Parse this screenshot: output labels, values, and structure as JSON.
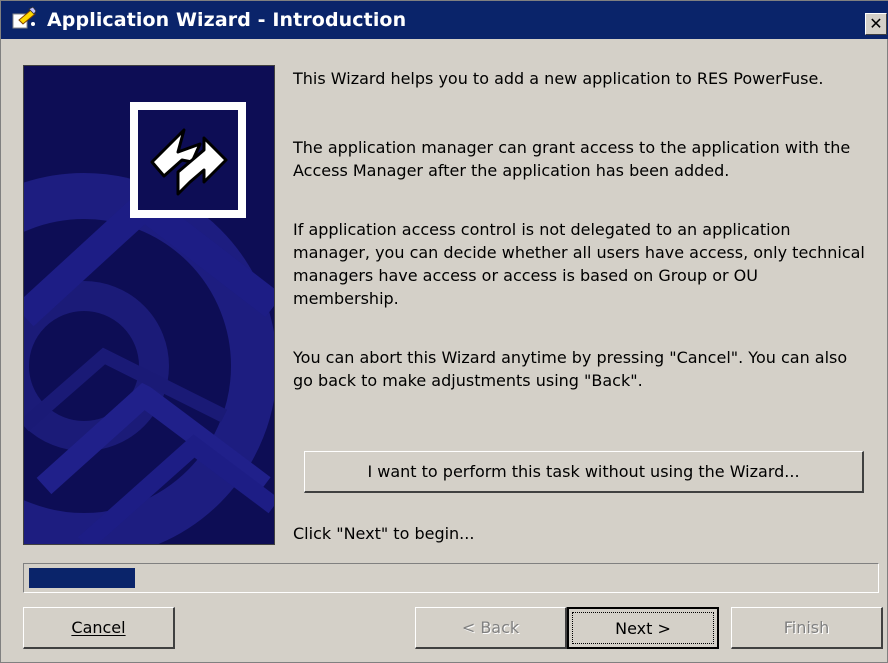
{
  "window": {
    "title": "Application Wizard - Introduction"
  },
  "intro": {
    "p1": "This Wizard helps you to add a new application to RES PowerFuse.",
    "p2": "The application manager can grant access to the application with the Access Manager after the application has been added.",
    "p3": "If application access control is not delegated to an application manager, you can decide whether all users have access, only technical managers have access or access is based on Group or OU membership.",
    "p4": "You can abort this Wizard anytime by pressing \"Cancel\". You can also go back to make adjustments using \"Back\".",
    "begin_hint": "Click \"Next\" to begin..."
  },
  "task_button_label": "I want to perform this task without using the Wizard...",
  "progress": {
    "value_fraction": 0.125
  },
  "buttons": {
    "cancel": "Cancel",
    "back": "< Back",
    "next": "Next >",
    "finish": "Finish"
  },
  "colors": {
    "titlebar": "#0a246a",
    "banner": "#0d0d55",
    "face": "#d4d0c8"
  },
  "icons": {
    "app": "wizard-icon",
    "close": "close-icon",
    "banner": "arrows-logo-icon"
  }
}
